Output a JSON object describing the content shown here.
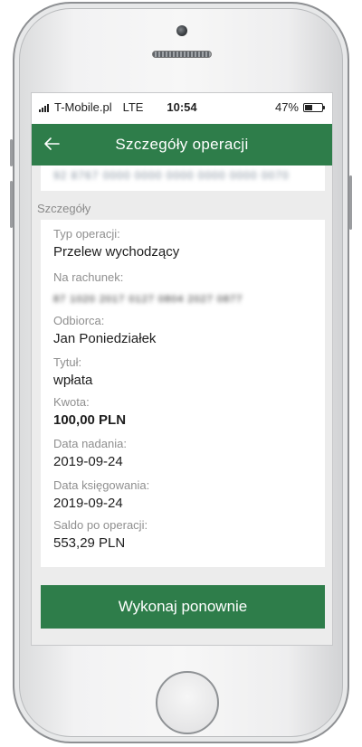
{
  "status_bar": {
    "carrier": "T-Mobile.pl",
    "network": "LTE",
    "time": "10:54",
    "battery_percent": "47%",
    "battery_level": 0.47
  },
  "app_bar": {
    "back_icon": "arrow-left-icon",
    "title": "Szczegóły operacji"
  },
  "previous_card": {
    "blurred_text": "92 8767 0000 0000 0000 0000 0000 0070"
  },
  "section": {
    "label": "Szczegóły"
  },
  "details": [
    {
      "label": "Typ operacji:",
      "value": "Przelew wychodzący"
    },
    {
      "label": "Na rachunek:",
      "value": "87 1020 2017 0127 0804 2027 0877"
    },
    {
      "label": "Odbiorca:",
      "value": "Jan Poniedziałek"
    },
    {
      "label": "Tytuł:",
      "value": "wpłata"
    },
    {
      "label": "Kwota:",
      "value": "100,00 PLN"
    },
    {
      "label": "Data nadania:",
      "value": "2019-09-24"
    },
    {
      "label": "Data księgowania:",
      "value": "2019-09-24"
    },
    {
      "label": "Saldo po operacji:",
      "value": "553,29 PLN"
    }
  ],
  "action": {
    "repeat_label": "Wykonaj ponownie"
  },
  "colors": {
    "brand_green": "#2e7d4a",
    "screen_background": "#ececec"
  }
}
